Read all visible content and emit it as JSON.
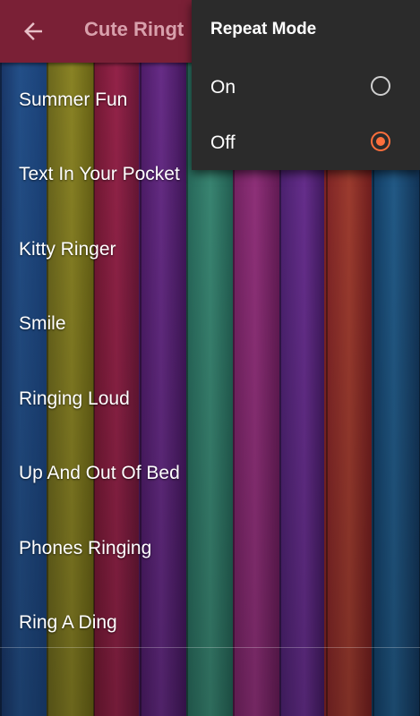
{
  "app_bar": {
    "title": "Cute Ringt",
    "back_icon": "arrow-left-icon",
    "color": "#7a2036"
  },
  "ringtones": [
    "Summer Fun",
    "Text In Your Pocket",
    "Kitty Ringer",
    "Smile",
    "Ringing Loud",
    "Up And Out Of Bed",
    "Phones Ringing",
    "Ring A Ding"
  ],
  "repeat_menu": {
    "title": "Repeat Mode",
    "options": [
      {
        "label": "On",
        "selected": false
      },
      {
        "label": "Off",
        "selected": true
      }
    ],
    "accent": "#ff6f3c"
  }
}
